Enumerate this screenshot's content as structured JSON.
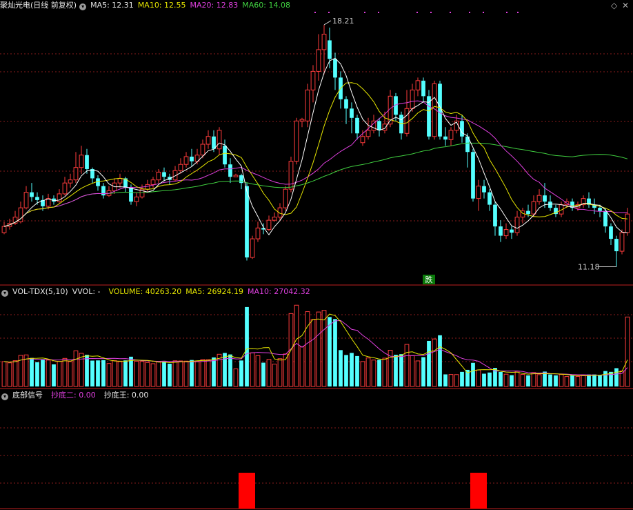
{
  "header": {
    "title": "聚灿光电(日线 前复权)",
    "ma5": "MA5: 12.31",
    "ma10": "MA10: 12.55",
    "ma20": "MA20: 12.83",
    "ma60": "MA60: 14.08",
    "icon_diamond": "diamond-icon",
    "icon_close": "close-icon"
  },
  "vol_header": {
    "name": "VOL-TDX(5,10)",
    "vvol": "VVOL: -",
    "volume": "VOLUME: 40263.20",
    "ma5": "MA5: 26924.19",
    "ma10": "MA10: 27042.32"
  },
  "signal_header": {
    "name": "底部信号",
    "s2": "抄底二: 0.00",
    "s3": "抄底王: 0.00"
  },
  "annotations": {
    "high_label": "18.21",
    "low_label": "11.18",
    "drop_label": "跌"
  },
  "colors": {
    "up": "#ff3c3c",
    "down": "#54ffff",
    "ma5": "#ffffff",
    "ma10": "#e6e600",
    "ma20": "#e040e0",
    "ma60": "#40d040",
    "grid": "#8a1c1c",
    "signal": "#ff0000"
  },
  "chart_data": {
    "type": "candlestick",
    "price_range": [
      10.2,
      18.7
    ],
    "volume_max": 52000,
    "candles": [
      [
        11.6,
        11.8,
        11.95,
        11.55
      ],
      [
        11.8,
        11.9,
        12.05,
        11.7
      ],
      [
        11.9,
        12.1,
        12.3,
        11.85
      ],
      [
        11.95,
        12.4,
        12.6,
        11.9
      ],
      [
        12.4,
        12.9,
        13.1,
        12.35
      ],
      [
        12.9,
        12.75,
        13.2,
        12.6
      ],
      [
        12.75,
        12.65,
        12.9,
        12.5
      ],
      [
        12.65,
        12.45,
        12.8,
        12.3
      ],
      [
        12.45,
        12.7,
        12.85,
        12.35
      ],
      [
        12.7,
        12.6,
        12.8,
        12.5
      ],
      [
        12.6,
        12.85,
        13.0,
        12.55
      ],
      [
        12.85,
        13.2,
        13.4,
        12.8
      ],
      [
        13.2,
        13.3,
        13.5,
        13.05
      ],
      [
        13.3,
        13.7,
        14.2,
        13.2
      ],
      [
        13.7,
        14.1,
        14.4,
        13.5
      ],
      [
        14.1,
        13.65,
        14.3,
        13.5
      ],
      [
        13.65,
        13.35,
        13.7,
        13.2
      ],
      [
        13.35,
        13.1,
        13.45,
        12.95
      ],
      [
        13.1,
        12.8,
        13.2,
        12.7
      ],
      [
        12.8,
        12.95,
        13.1,
        12.75
      ],
      [
        12.95,
        13.2,
        13.35,
        12.85
      ],
      [
        13.2,
        13.35,
        13.5,
        13.05
      ],
      [
        13.35,
        13.05,
        13.4,
        12.9
      ],
      [
        13.05,
        12.6,
        13.15,
        12.5
      ],
      [
        12.6,
        12.75,
        12.9,
        12.45
      ],
      [
        12.75,
        13.0,
        13.15,
        12.7
      ],
      [
        13.0,
        13.15,
        13.3,
        12.9
      ],
      [
        13.15,
        13.3,
        13.4,
        13.05
      ],
      [
        13.3,
        13.55,
        13.65,
        13.2
      ],
      [
        13.55,
        13.4,
        13.7,
        13.25
      ],
      [
        13.4,
        13.3,
        13.5,
        13.15
      ],
      [
        13.3,
        13.6,
        13.75,
        13.25
      ],
      [
        13.6,
        13.8,
        14.0,
        13.5
      ],
      [
        13.8,
        14.05,
        14.2,
        13.7
      ],
      [
        14.05,
        13.9,
        14.3,
        13.75
      ],
      [
        13.9,
        14.1,
        14.3,
        13.8
      ],
      [
        14.1,
        14.45,
        14.6,
        14.0
      ],
      [
        14.45,
        14.7,
        14.9,
        14.3
      ],
      [
        14.7,
        14.3,
        14.9,
        14.2
      ],
      [
        14.3,
        14.9,
        15.0,
        14.1
      ],
      [
        14.4,
        13.8,
        14.6,
        13.7
      ],
      [
        13.8,
        13.4,
        14.0,
        13.2
      ],
      [
        13.4,
        13.45,
        13.5,
        13.4
      ],
      [
        13.45,
        13.2,
        13.5,
        13.0
      ],
      [
        13.1,
        10.8,
        13.2,
        10.7
      ],
      [
        10.8,
        11.4,
        11.5,
        10.75
      ],
      [
        11.4,
        11.75,
        11.95,
        11.3
      ],
      [
        11.75,
        11.7,
        11.9,
        11.55
      ],
      [
        11.7,
        12.0,
        12.15,
        11.65
      ],
      [
        12.0,
        12.1,
        12.25,
        11.95
      ],
      [
        12.1,
        12.4,
        12.55,
        12.0
      ],
      [
        12.4,
        13.0,
        13.1,
        12.3
      ],
      [
        13.0,
        13.9,
        14.05,
        12.9
      ],
      [
        13.9,
        15.2,
        15.3,
        13.8
      ],
      [
        15.2,
        15.25,
        15.3,
        15.0
      ],
      [
        15.2,
        16.2,
        16.4,
        15.0
      ],
      [
        16.2,
        16.8,
        17.0,
        15.8
      ],
      [
        16.8,
        17.5,
        18.0,
        16.5
      ],
      [
        17.5,
        18.0,
        18.3,
        16.7
      ],
      [
        17.8,
        17.2,
        18.21,
        16.9
      ],
      [
        17.2,
        16.6,
        17.4,
        16.2
      ],
      [
        16.6,
        15.9,
        16.8,
        15.6
      ],
      [
        15.9,
        15.6,
        16.0,
        15.1
      ],
      [
        15.6,
        15.3,
        15.8,
        14.8
      ],
      [
        15.3,
        14.8,
        15.4,
        14.6
      ],
      [
        14.5,
        14.7,
        14.9,
        14.4
      ],
      [
        14.7,
        14.9,
        15.3,
        14.6
      ],
      [
        14.9,
        15.2,
        15.4,
        14.8
      ],
      [
        15.2,
        14.9,
        15.3,
        14.7
      ],
      [
        14.9,
        15.1,
        15.5,
        14.8
      ],
      [
        15.1,
        16.0,
        16.2,
        15.0
      ],
      [
        16.0,
        15.4,
        16.1,
        15.2
      ],
      [
        15.4,
        14.8,
        15.5,
        14.6
      ],
      [
        14.8,
        15.6,
        16.2,
        14.7
      ],
      [
        15.6,
        16.2,
        16.4,
        15.5
      ],
      [
        16.2,
        16.5,
        16.6,
        16.0
      ],
      [
        16.5,
        16.0,
        16.6,
        15.8
      ],
      [
        16.0,
        14.7,
        16.2,
        14.6
      ],
      [
        14.7,
        16.4,
        16.5,
        14.6
      ],
      [
        16.4,
        14.7,
        16.5,
        14.6
      ],
      [
        14.7,
        14.6,
        15.0,
        14.4
      ],
      [
        14.6,
        14.9,
        15.0,
        14.4
      ],
      [
        14.9,
        15.2,
        15.4,
        14.8
      ],
      [
        15.2,
        14.7,
        15.4,
        14.5
      ],
      [
        14.7,
        14.2,
        14.8,
        13.7
      ],
      [
        14.2,
        12.7,
        14.3,
        12.6
      ],
      [
        12.7,
        13.1,
        13.3,
        12.3
      ],
      [
        13.1,
        12.9,
        13.3,
        12.7
      ],
      [
        12.9,
        12.5,
        13.0,
        12.3
      ],
      [
        12.5,
        11.8,
        12.6,
        11.5
      ],
      [
        11.8,
        11.5,
        12.0,
        11.3
      ],
      [
        11.5,
        11.7,
        11.9,
        11.4
      ],
      [
        11.7,
        11.6,
        11.8,
        11.4
      ],
      [
        11.6,
        12.1,
        12.3,
        11.5
      ],
      [
        12.1,
        12.3,
        12.4,
        11.9
      ],
      [
        12.3,
        12.2,
        12.5,
        12.1
      ],
      [
        12.2,
        12.6,
        12.8,
        12.1
      ],
      [
        12.6,
        12.8,
        13.0,
        12.5
      ],
      [
        12.8,
        12.6,
        13.2,
        12.4
      ],
      [
        12.6,
        12.4,
        12.8,
        12.3
      ],
      [
        12.4,
        12.2,
        12.5,
        12.1
      ],
      [
        12.2,
        12.5,
        12.6,
        12.1
      ],
      [
        12.5,
        12.6,
        12.7,
        12.4
      ],
      [
        12.6,
        12.4,
        12.7,
        12.3
      ],
      [
        12.4,
        12.5,
        12.6,
        12.3
      ],
      [
        12.5,
        12.7,
        12.8,
        12.4
      ],
      [
        12.7,
        12.5,
        12.9,
        12.4
      ],
      [
        12.5,
        12.4,
        12.7,
        12.2
      ],
      [
        12.4,
        12.3,
        12.5,
        12.1
      ],
      [
        12.3,
        11.8,
        12.4,
        11.6
      ],
      [
        11.8,
        11.4,
        11.9,
        11.2
      ],
      [
        11.4,
        11.0,
        11.5,
        10.5
      ],
      [
        11.0,
        11.6,
        11.7,
        10.9
      ],
      [
        11.6,
        12.2,
        12.4,
        11.5
      ]
    ],
    "volume_ma5_last": 26924.19,
    "volume_ma10_last": 27042.32,
    "volume_last": 40263.2,
    "signal_bars": [
      44,
      86
    ]
  }
}
